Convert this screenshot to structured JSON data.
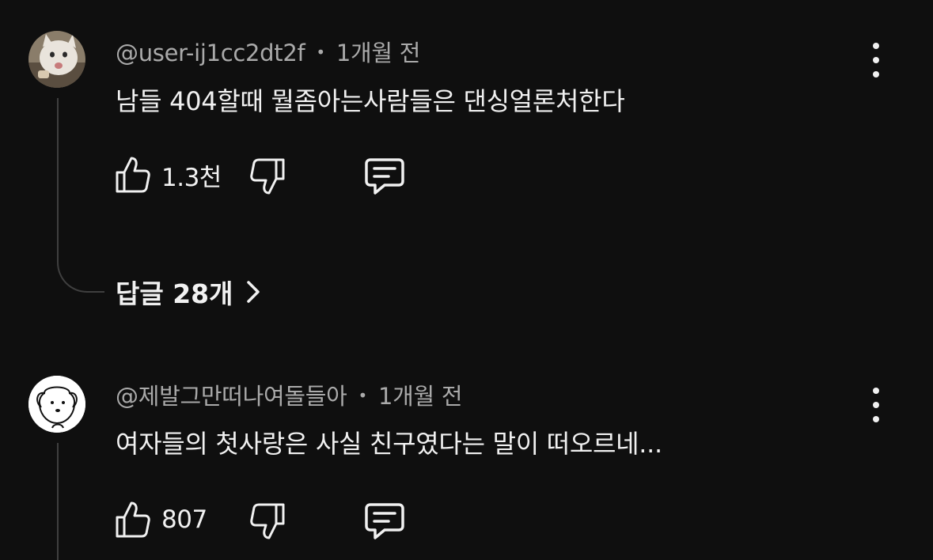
{
  "comments": [
    {
      "author": "@user-ij1cc2dt2f",
      "separator": "•",
      "time": "1개월 전",
      "text": "남들 404할때 뭘좀아는사람들은 댄싱얼론처한다",
      "likes": "1.3천",
      "avatar": "cat-avatar",
      "replies_label": "답글 28개"
    },
    {
      "author": "@제발그만떠나여돌들아",
      "separator": "•",
      "time": "1개월 전",
      "text": "여자들의 첫사랑은 사실 친구였다는 말이 떠오르네...",
      "likes": "807",
      "avatar": "dog-avatar"
    }
  ],
  "icons": {
    "like": "thumbs-up-icon",
    "dislike": "thumbs-down-icon",
    "reply": "reply-icon",
    "more": "more-vertical-icon",
    "chevron": "chevron-right-icon"
  },
  "colors": {
    "background": "#0f0f0f",
    "text": "#f1f1f1",
    "meta": "#aaaaaa",
    "thread": "#3f3f3f"
  }
}
